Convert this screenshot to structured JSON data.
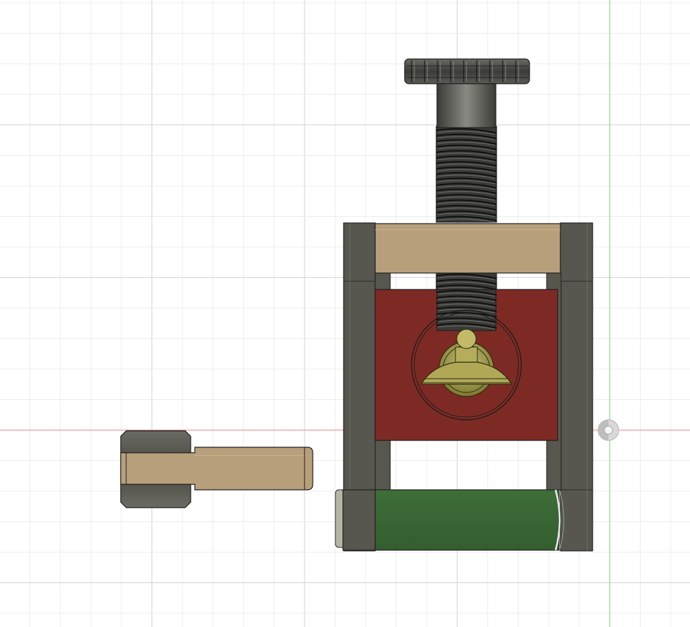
{
  "viewport": {
    "background": "#ffffff",
    "grid_minor_color": "#ececec",
    "grid_major_color": "#d2d2d2",
    "x_axis_color": "#f08080",
    "y_axis_color": "#7fe07f"
  },
  "parts": {
    "knob": {
      "color": "#4a4a46"
    },
    "screw": {
      "color": "#2a2a2a"
    },
    "top_plate": {
      "color": "#b89f7c"
    },
    "frame_posts": {
      "color": "#57574f"
    },
    "slider_block": {
      "color": "#7e2a24"
    },
    "presser_foot": {
      "color": "#a39a4a"
    },
    "bottom_roller": {
      "color": "#3c6a37"
    },
    "handle": {
      "color": "#b89f7c"
    },
    "handle_end": {
      "color": "#5a5a54"
    }
  },
  "origin_marker": {
    "name": "origin-point-icon"
  }
}
